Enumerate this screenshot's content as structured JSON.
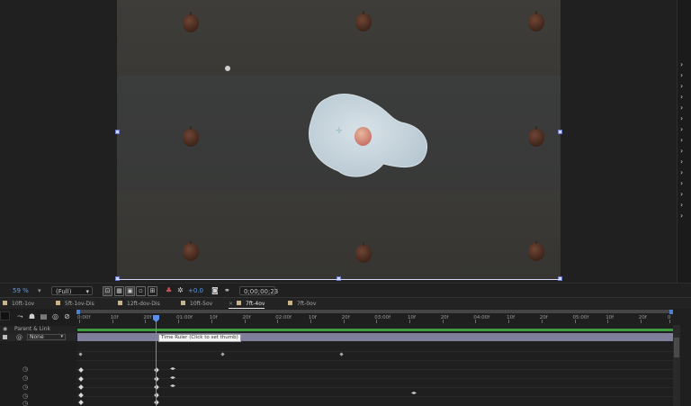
{
  "viewer": {
    "zoom": "59 %",
    "resolution": "(Full)",
    "exposure": "+0.0",
    "timecode": "0;00;00;23"
  },
  "tabs": [
    {
      "label": "10ft-1ov",
      "active": false
    },
    {
      "label": "5ft-1ov-Dis",
      "active": false
    },
    {
      "label": "12ft-dov-Dis",
      "active": false
    },
    {
      "label": "10ft-5ov",
      "active": false
    },
    {
      "label": "7ft-4ov",
      "active": true
    },
    {
      "label": "7ft-0ov",
      "active": false
    }
  ],
  "timeline": {
    "column_header": "Parent & Link",
    "parent_value": "None",
    "ruler_ticks": [
      "0:00f",
      "10f",
      "20f",
      "01:00f",
      "10f",
      "20f",
      "02:00f",
      "10f",
      "20f",
      "03:00f",
      "10f",
      "20f",
      "04:00f",
      "10f",
      "20f",
      "05:00f",
      "10f",
      "20f",
      "0"
    ],
    "tooltip": "Time Ruler (Click to set thumb)"
  },
  "icons": {
    "close_tab": "×",
    "dropdown": "▾",
    "chevron": "›"
  },
  "colors": {
    "accent": "#5e8fe8",
    "layer_bar": "#7f7f9c",
    "work_area": "#3e9a3e",
    "label_swatch": "#c9b48a"
  }
}
